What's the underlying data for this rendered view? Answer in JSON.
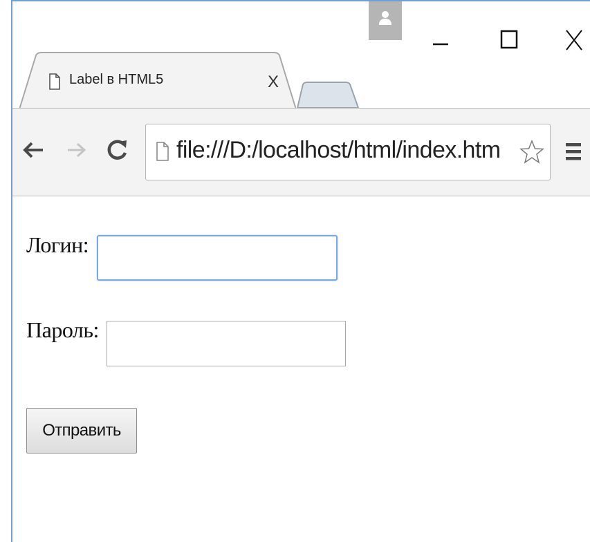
{
  "browser": {
    "tab": {
      "title": "Label в HTML5",
      "close_label": "X"
    },
    "address_bar": {
      "url": "file:///D:/localhost/html/index.htm"
    },
    "icons": {
      "back": "back-arrow-icon",
      "forward": "forward-arrow-icon",
      "reload": "reload-icon",
      "page": "page-icon",
      "bookmark": "star-icon",
      "menu": "hamburger-menu-icon",
      "user": "user-icon",
      "minimize": "minimize-icon",
      "maximize": "maximize-icon",
      "close": "close-icon"
    },
    "colors": {
      "window_border": "#6f9fd3",
      "toolbar_bg": "#f3f3f3",
      "focus_ring": "#7aa7ea"
    }
  },
  "form": {
    "login": {
      "label": "Логин:",
      "value": ""
    },
    "password": {
      "label": "Пароль:",
      "value": ""
    },
    "submit_label": "Отправить"
  }
}
